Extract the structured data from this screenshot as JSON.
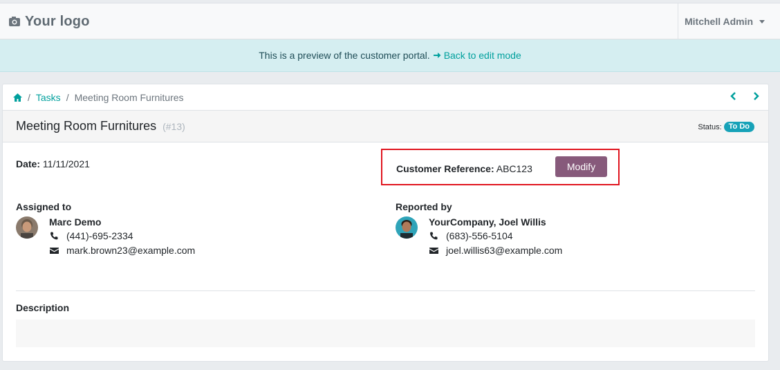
{
  "navbar": {
    "brand": "Your logo",
    "user_name": "Mitchell Admin"
  },
  "preview": {
    "message": "This is a preview of the customer portal.",
    "link": "Back to edit mode"
  },
  "breadcrumb": {
    "items": [
      "Tasks"
    ],
    "current": "Meeting Room Furnitures"
  },
  "task": {
    "title": "Meeting Room Furnitures",
    "number": "(#13)",
    "status_label": "Status:",
    "status": "To Do",
    "date_label": "Date:",
    "date": "11/11/2021",
    "customer_ref_label": "Customer Reference:",
    "customer_ref": "ABC123",
    "modify_label": "Modify"
  },
  "assigned": {
    "label": "Assigned to",
    "name": "Marc Demo",
    "phone": "(441)-695-2334",
    "email": "mark.brown23@example.com"
  },
  "reported": {
    "label": "Reported by",
    "name": "YourCompany, Joel Willis",
    "phone": "(683)-556-5104",
    "email": "joel.willis63@example.com"
  },
  "description": {
    "label": "Description"
  },
  "colors": {
    "accent": "#00a09d",
    "primary": "#875a7b",
    "badge": "#17a2b8",
    "highlight": "#e0141e"
  }
}
